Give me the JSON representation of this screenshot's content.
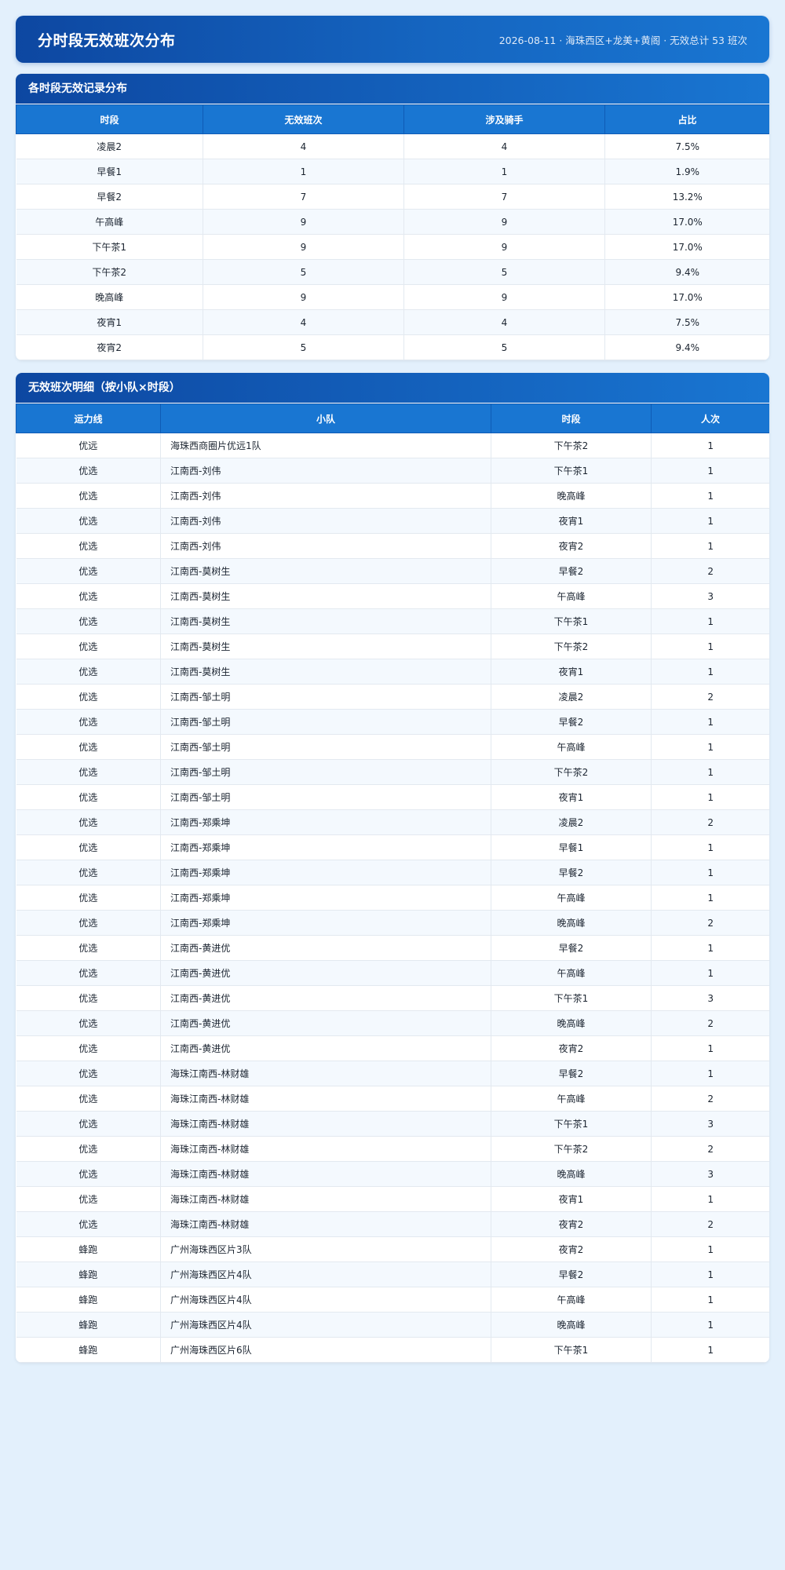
{
  "header": {
    "title": "分时段无效班次分布",
    "meta": "2026-08-11 · 海珠西区+龙美+黄阁 · 无效总计 53 班次"
  },
  "summary": {
    "title": "各时段无效记录分布",
    "columns": [
      "时段",
      "无效班次",
      "涉及骑手",
      "占比"
    ],
    "rows": [
      [
        "凌晨2",
        "4",
        "4",
        "7.5%"
      ],
      [
        "早餐1",
        "1",
        "1",
        "1.9%"
      ],
      [
        "早餐2",
        "7",
        "7",
        "13.2%"
      ],
      [
        "午高峰",
        "9",
        "9",
        "17.0%"
      ],
      [
        "下午茶1",
        "9",
        "9",
        "17.0%"
      ],
      [
        "下午茶2",
        "5",
        "5",
        "9.4%"
      ],
      [
        "晚高峰",
        "9",
        "9",
        "17.0%"
      ],
      [
        "夜宵1",
        "4",
        "4",
        "7.5%"
      ],
      [
        "夜宵2",
        "5",
        "5",
        "9.4%"
      ]
    ]
  },
  "detail": {
    "title": "无效班次明细（按小队×时段）",
    "columns": [
      "运力线",
      "小队",
      "时段",
      "人次"
    ],
    "rows": [
      [
        "优远",
        "海珠西商圈片优远1队",
        "下午茶2",
        "1"
      ],
      [
        "优选",
        "江南西-刘伟",
        "下午茶1",
        "1"
      ],
      [
        "优选",
        "江南西-刘伟",
        "晚高峰",
        "1"
      ],
      [
        "优选",
        "江南西-刘伟",
        "夜宵1",
        "1"
      ],
      [
        "优选",
        "江南西-刘伟",
        "夜宵2",
        "1"
      ],
      [
        "优选",
        "江南西-莫树生",
        "早餐2",
        "2"
      ],
      [
        "优选",
        "江南西-莫树生",
        "午高峰",
        "3"
      ],
      [
        "优选",
        "江南西-莫树生",
        "下午茶1",
        "1"
      ],
      [
        "优选",
        "江南西-莫树生",
        "下午茶2",
        "1"
      ],
      [
        "优选",
        "江南西-莫树生",
        "夜宵1",
        "1"
      ],
      [
        "优选",
        "江南西-邹土明",
        "凌晨2",
        "2"
      ],
      [
        "优选",
        "江南西-邹土明",
        "早餐2",
        "1"
      ],
      [
        "优选",
        "江南西-邹土明",
        "午高峰",
        "1"
      ],
      [
        "优选",
        "江南西-邹土明",
        "下午茶2",
        "1"
      ],
      [
        "优选",
        "江南西-邹土明",
        "夜宵1",
        "1"
      ],
      [
        "优选",
        "江南西-郑乘坤",
        "凌晨2",
        "2"
      ],
      [
        "优选",
        "江南西-郑乘坤",
        "早餐1",
        "1"
      ],
      [
        "优选",
        "江南西-郑乘坤",
        "早餐2",
        "1"
      ],
      [
        "优选",
        "江南西-郑乘坤",
        "午高峰",
        "1"
      ],
      [
        "优选",
        "江南西-郑乘坤",
        "晚高峰",
        "2"
      ],
      [
        "优选",
        "江南西-黄进优",
        "早餐2",
        "1"
      ],
      [
        "优选",
        "江南西-黄进优",
        "午高峰",
        "1"
      ],
      [
        "优选",
        "江南西-黄进优",
        "下午茶1",
        "3"
      ],
      [
        "优选",
        "江南西-黄进优",
        "晚高峰",
        "2"
      ],
      [
        "优选",
        "江南西-黄进优",
        "夜宵2",
        "1"
      ],
      [
        "优选",
        "海珠江南西-林财雄",
        "早餐2",
        "1"
      ],
      [
        "优选",
        "海珠江南西-林财雄",
        "午高峰",
        "2"
      ],
      [
        "优选",
        "海珠江南西-林财雄",
        "下午茶1",
        "3"
      ],
      [
        "优选",
        "海珠江南西-林财雄",
        "下午茶2",
        "2"
      ],
      [
        "优选",
        "海珠江南西-林财雄",
        "晚高峰",
        "3"
      ],
      [
        "优选",
        "海珠江南西-林财雄",
        "夜宵1",
        "1"
      ],
      [
        "优选",
        "海珠江南西-林财雄",
        "夜宵2",
        "2"
      ],
      [
        "蜂跑",
        "广州海珠西区片3队",
        "夜宵2",
        "1"
      ],
      [
        "蜂跑",
        "广州海珠西区片4队",
        "早餐2",
        "1"
      ],
      [
        "蜂跑",
        "广州海珠西区片4队",
        "午高峰",
        "1"
      ],
      [
        "蜂跑",
        "广州海珠西区片4队",
        "晚高峰",
        "1"
      ],
      [
        "蜂跑",
        "广州海珠西区片6队",
        "下午茶1",
        "1"
      ]
    ]
  },
  "colors": {
    "page_background": "#e3f0fc",
    "header_dark": "#0d47a1",
    "header_light": "#1976d2",
    "table_header": "#1976d2",
    "row_alt": "#f4f9fe"
  }
}
